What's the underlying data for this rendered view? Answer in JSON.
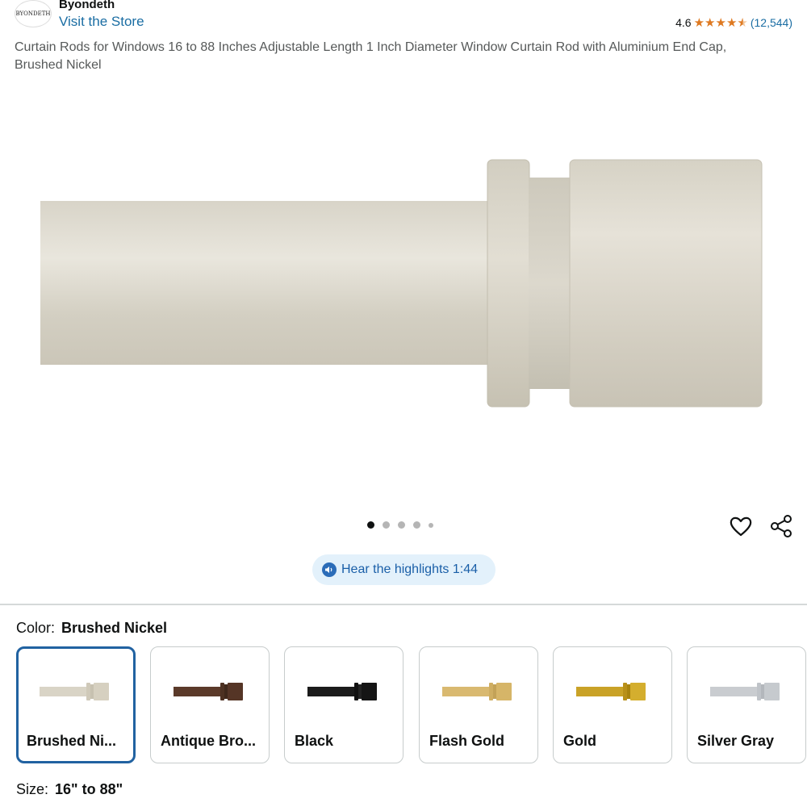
{
  "brand": {
    "logo_text": "BYONDETH",
    "name": "Byondeth",
    "visit_store": "Visit the Store"
  },
  "rating": {
    "value": "4.6",
    "stars": 4.6,
    "count": "(12,544)"
  },
  "product": {
    "title": "Curtain Rods for Windows 16 to 88 Inches Adjustable Length 1 Inch Diameter Window Curtain Rod with Aluminium End Cap, Brushed Nickel"
  },
  "carousel": {
    "total_images": 5,
    "active_index": 0
  },
  "highlights": {
    "label": "Hear the highlights 1:44"
  },
  "color": {
    "label": "Color:",
    "selected": "Brushed Nickel",
    "options": [
      {
        "name": "Brushed Ni...",
        "rod_color": "#d9d4c6",
        "cap_color": "#cfc9b9",
        "selected": true
      },
      {
        "name": "Antique Bro...",
        "rod_color": "#5b3a2a",
        "cap_color": "#4d3122",
        "selected": false
      },
      {
        "name": "Black",
        "rod_color": "#1b1b1b",
        "cap_color": "#111111",
        "selected": false
      },
      {
        "name": "Flash Gold",
        "rod_color": "#d9b970",
        "cap_color": "#cfae62",
        "selected": false
      },
      {
        "name": "Gold",
        "rod_color": "#c9a227",
        "cap_color": "#b8901a",
        "selected": false
      },
      {
        "name": "Silver Gray",
        "rod_color": "#c9ccd0",
        "cap_color": "#bfc3c8",
        "selected": false
      }
    ]
  },
  "size": {
    "label": "Size:",
    "value": "16\" to 88\""
  },
  "colors": {
    "link": "#1a6da3",
    "star": "#de7921",
    "selected_border": "#2162a1"
  }
}
